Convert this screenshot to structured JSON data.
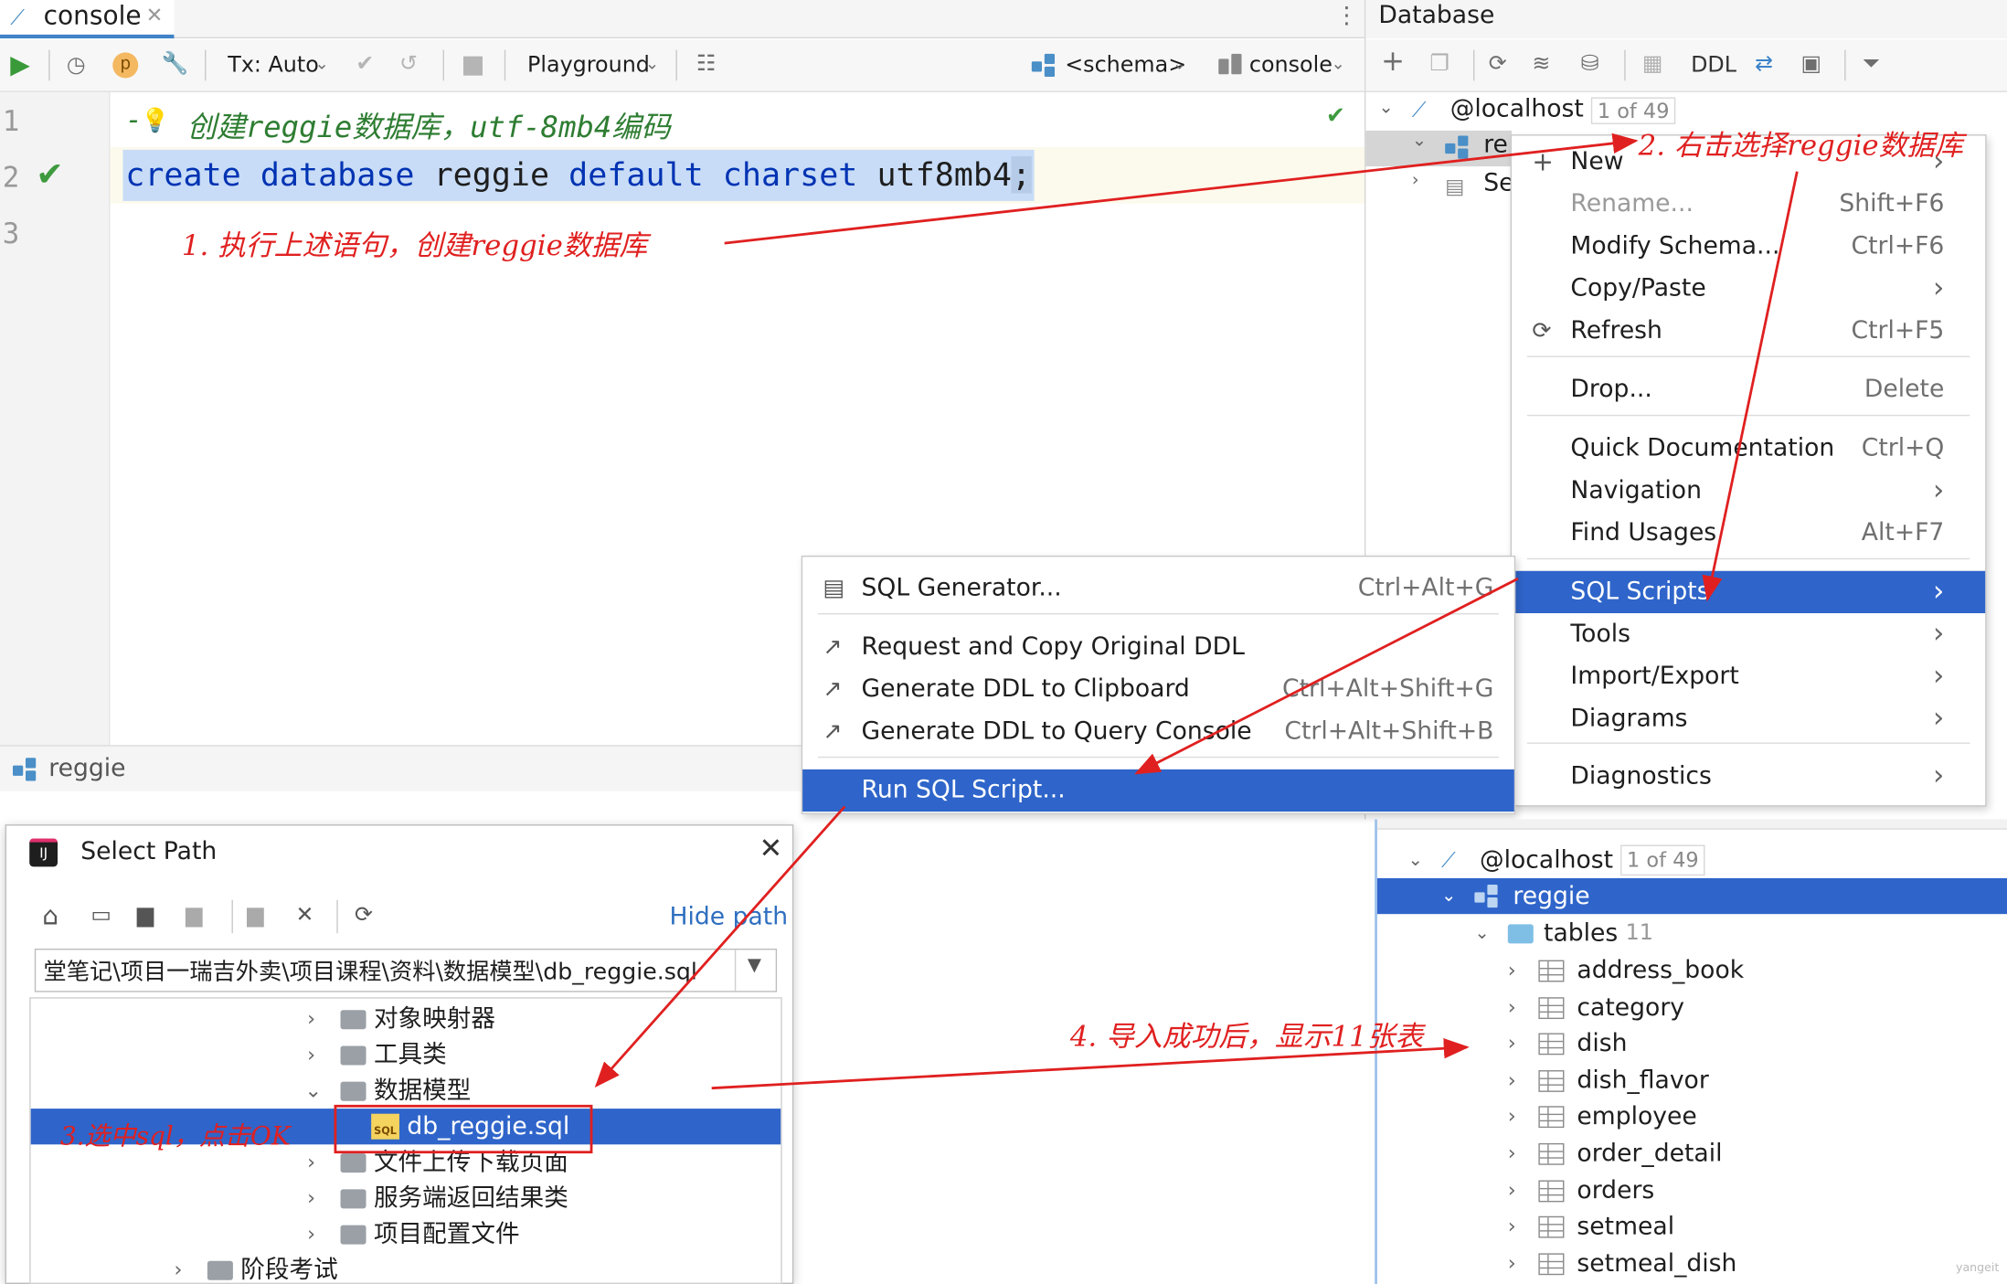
{
  "editor": {
    "tab_label": "console",
    "toolbar": {
      "tx": "Tx: Auto",
      "playground": "Playground",
      "schema": "<schema>",
      "console": "console"
    },
    "lines": [
      "1",
      "2",
      "3"
    ],
    "comment": "-- 创建reggie数据库，utf-8mb4编码",
    "comment_text": "创建reggie数据库，utf-8mb4编码",
    "comment_dash": "-",
    "code": {
      "kw1": "create",
      "kw2": "database",
      "name": "reggie",
      "kw3": "default",
      "kw4": "charset",
      "val": "utf8mb4",
      "end": ";"
    },
    "status_schema": "reggie"
  },
  "database_panel": {
    "title": "Database",
    "ddl_label": "DDL",
    "host": "@localhost",
    "host_badge": "1 of 49",
    "tree_partial_1": "re",
    "tree_partial_2": "Se"
  },
  "context_menu": {
    "items": [
      {
        "label": "New",
        "shortcut": ""
      },
      {
        "label": "Rename...",
        "shortcut": "Shift+F6"
      },
      {
        "label": "Modify Schema...",
        "shortcut": "Ctrl+F6"
      },
      {
        "label": "Copy/Paste",
        "shortcut": ""
      },
      {
        "label": "Refresh",
        "shortcut": "Ctrl+F5"
      },
      {
        "label": "Drop...",
        "shortcut": "Delete"
      },
      {
        "label": "Quick Documentation",
        "shortcut": "Ctrl+Q"
      },
      {
        "label": "Navigation",
        "shortcut": ""
      },
      {
        "label": "Find Usages",
        "shortcut": "Alt+F7"
      },
      {
        "label": "SQL Scripts",
        "shortcut": ""
      },
      {
        "label": "Tools",
        "shortcut": ""
      },
      {
        "label": "Import/Export",
        "shortcut": ""
      },
      {
        "label": "Diagrams",
        "shortcut": ""
      },
      {
        "label": "Diagnostics",
        "shortcut": ""
      }
    ]
  },
  "submenu": {
    "items": [
      {
        "label": "SQL Generator...",
        "shortcut": "Ctrl+Alt+G"
      },
      {
        "label": "Request and Copy Original DDL",
        "shortcut": ""
      },
      {
        "label": "Generate DDL to Clipboard",
        "shortcut": "Ctrl+Alt+Shift+G"
      },
      {
        "label": "Generate DDL to Query Console",
        "shortcut": "Ctrl+Alt+Shift+B"
      },
      {
        "label": "Run SQL Script...",
        "shortcut": ""
      }
    ]
  },
  "select_path": {
    "title": "Select Path",
    "hide_path": "Hide path",
    "path_value": "堂笔记\\项目一瑞吉外卖\\项目课程\\资料\\数据模型\\db_reggie.sql",
    "tree": [
      "对象映射器",
      "工具类",
      "数据模型",
      "db_reggie.sql",
      "文件上传下载页面",
      "服务端返回结果类",
      "项目配置文件",
      "阶段考试"
    ]
  },
  "result_tree": {
    "host": "@localhost",
    "host_badge": "1 of 49",
    "db": "reggie",
    "tables_label": "tables",
    "tables_count": "11",
    "tables": [
      "address_book",
      "category",
      "dish",
      "dish_flavor",
      "employee",
      "order_detail",
      "orders",
      "setmeal",
      "setmeal_dish"
    ]
  },
  "annotations": {
    "step1": "1. 执行上述语句，创建reggie数据库",
    "step2": "2. 右击选择reggie数据库",
    "step3": "3.选中sql，点击OK",
    "step4": "4. 导入成功后，显示11张表",
    "watermark": "yangeit"
  },
  "colors": {
    "selection": "#2f65ca",
    "annotation_red": "#e02020",
    "keyword": "#0033b3",
    "comment": "#2e7d32"
  }
}
